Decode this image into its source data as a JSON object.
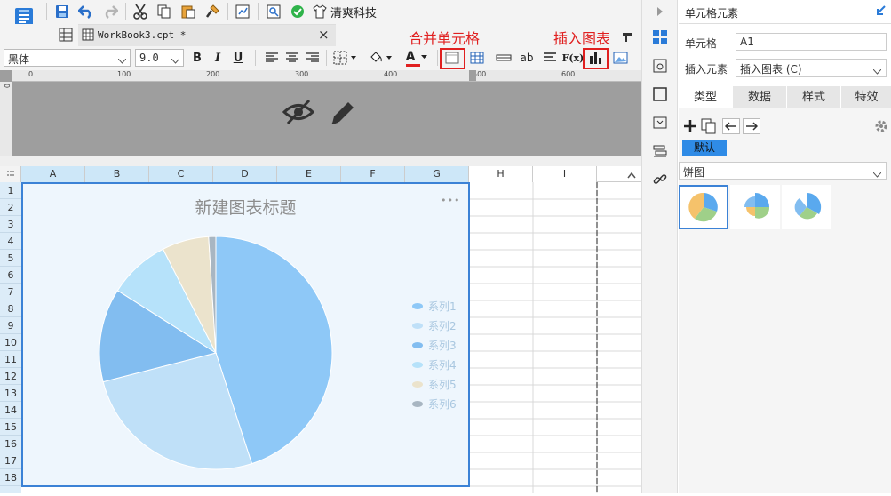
{
  "toolbar": {
    "brand_label": "清爽科技"
  },
  "tab": {
    "title": "WorkBook3.cpt *",
    "close": "×"
  },
  "format_bar": {
    "font_name": "黑体",
    "font_size": "9.0",
    "bold": "B",
    "italic": "I",
    "underline": "U",
    "wrap_label": "ab",
    "formula_label": "F(x)",
    "font_color": "#e02020"
  },
  "annotations": {
    "merge_cells": "合并单元格",
    "insert_chart": "插入图表"
  },
  "ruler": {
    "ticks": [
      "0",
      "100",
      "200",
      "300",
      "400",
      "500",
      "600"
    ],
    "left_tick": "0"
  },
  "columns": [
    "A",
    "B",
    "C",
    "D",
    "E",
    "F",
    "G",
    "H",
    "I"
  ],
  "rows": [
    "1",
    "2",
    "3",
    "4",
    "5",
    "6",
    "7",
    "8",
    "9",
    "10",
    "11",
    "12",
    "13",
    "14",
    "15",
    "16",
    "17",
    "18"
  ],
  "chart": {
    "more": "•••"
  },
  "chart_data": {
    "type": "pie",
    "title": "新建图表标题",
    "series": [
      {
        "name": "系列1",
        "value": 45,
        "color": "#8ec8f7"
      },
      {
        "name": "系列2",
        "value": 26,
        "color": "#bfe0f8"
      },
      {
        "name": "系列3",
        "value": 13,
        "color": "#82bdf0"
      },
      {
        "name": "系列4",
        "value": 8.5,
        "color": "#b6e2fa"
      },
      {
        "name": "系列5",
        "value": 6.5,
        "color": "#ebe3cc"
      },
      {
        "name": "系列6",
        "value": 1,
        "color": "#a8b6c2"
      }
    ],
    "legend_position": "right"
  },
  "right_panel": {
    "title": "单元格元素",
    "cell_label": "单元格",
    "cell_value": "A1",
    "insert_label": "插入元素",
    "insert_value": "插入图表 (C)",
    "tabs": [
      "类型",
      "数据",
      "样式",
      "特效"
    ],
    "default_tag": "默认",
    "chart_type": "饼图"
  },
  "colors": {
    "accent": "#3b82d6",
    "annotation_red": "#e02020"
  }
}
